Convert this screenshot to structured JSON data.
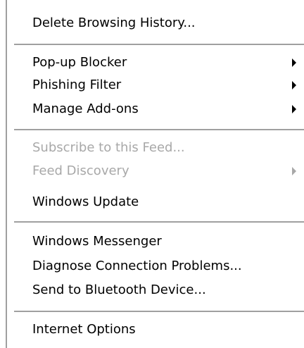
{
  "menu": {
    "items": [
      {
        "label": "Delete Browsing History...",
        "enabled": true,
        "submenu": false
      },
      {
        "label": "Pop-up Blocker",
        "enabled": true,
        "submenu": true
      },
      {
        "label": "Phishing Filter",
        "enabled": true,
        "submenu": true
      },
      {
        "label": "Manage Add-ons",
        "enabled": true,
        "submenu": true
      },
      {
        "label": "Subscribe to this Feed...",
        "enabled": false,
        "submenu": false
      },
      {
        "label": "Feed Discovery",
        "enabled": false,
        "submenu": true
      },
      {
        "label": "Windows Update",
        "enabled": true,
        "submenu": false
      },
      {
        "label": "Windows Messenger",
        "enabled": true,
        "submenu": false
      },
      {
        "label": "Diagnose Connection Problems...",
        "enabled": true,
        "submenu": false
      },
      {
        "label": "Send to Bluetooth Device...",
        "enabled": true,
        "submenu": false
      },
      {
        "label": "Internet Options",
        "enabled": true,
        "submenu": false
      }
    ],
    "colors": {
      "text": "#000000",
      "disabled_text": "#a8a8a8",
      "separator": "#a0a0a0",
      "background": "#ffffff"
    }
  }
}
